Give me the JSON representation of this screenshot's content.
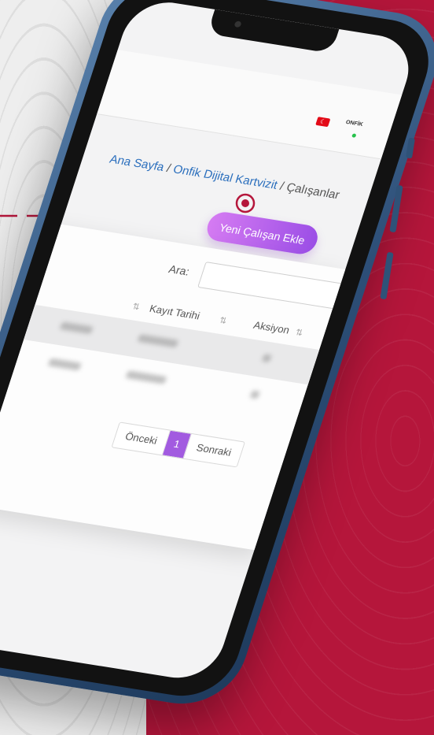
{
  "header": {
    "flag_icon": "turkey-flag-icon",
    "logo_text": "ONFİK",
    "status_dot_color": "#27c24c"
  },
  "breadcrumb": {
    "home": "Ana Sayfa",
    "section": "Onfik Dijital Kartvizit",
    "current": "Çalışanlar",
    "separator": "/"
  },
  "toolbar": {
    "add_employee_label": "Yeni Çalışan Ekle"
  },
  "table": {
    "search_label": "Ara:",
    "search_value": "",
    "columns": [
      {
        "label": "Kayıt Tarihi"
      },
      {
        "label": "Aksiyon"
      }
    ]
  },
  "pagination": {
    "prev_label": "Önceki",
    "current_page": "1",
    "next_label": "Sonraki"
  },
  "colors": {
    "background": "#b5163b",
    "accent": "#a25be0",
    "link": "#2b6fbd"
  }
}
